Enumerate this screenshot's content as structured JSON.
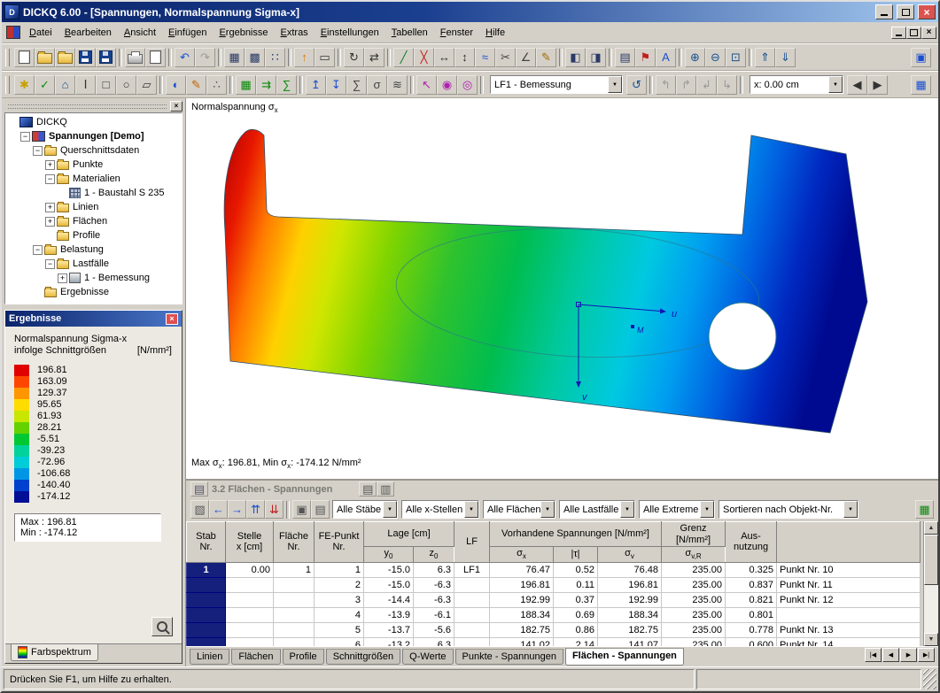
{
  "window": {
    "title": "DICKQ 6.00 - [Spannungen, Normalspannung Sigma-x]",
    "status": "Drücken Sie F1, um Hilfe zu erhalten."
  },
  "menu": {
    "items": [
      "Datei",
      "Bearbeiten",
      "Ansicht",
      "Einfügen",
      "Ergebnisse",
      "Extras",
      "Einstellungen",
      "Tabellen",
      "Fenster",
      "Hilfe"
    ]
  },
  "toolbars": {
    "main": [
      "new-file",
      "open-file",
      "open-project",
      "save",
      "save-all",
      "|",
      "print",
      "print-preview",
      "|",
      "undo",
      "redo",
      "|",
      "show-tables",
      "show-grid",
      "snap-points",
      "|",
      "move-node",
      "insert-rect",
      "|",
      "rotate-view",
      "mirror-object",
      "|",
      "insert-line",
      "delete-object",
      "dim-horizontal",
      "dim-vertical",
      "insert-polyline",
      "divide-line",
      "measure-angle",
      "edit-pencil",
      "|",
      "toggle-navigator",
      "toggle-tables",
      "|",
      "print-report",
      "edit-flag",
      "add-label",
      "|",
      "zoom-in",
      "zoom-out",
      "zoom-window",
      "|",
      "renumber-up",
      "renumber-down"
    ],
    "main_right": [
      "arrange-windows"
    ],
    "view_a": [
      "select-special",
      "check-input",
      "draw-polygon",
      "insert-beam",
      "draw-rect",
      "draw-circle",
      "region-tool",
      "|",
      "paint-fill",
      "paint-brush",
      "paint-spray",
      "|",
      "result-area",
      "result-arrows",
      "result-values",
      "|",
      "diagram-up",
      "diagram-down",
      "diagram-sum",
      "diagram-sigma",
      "diagram-smooth",
      "|",
      "pick-point",
      "show-point",
      "highlight-point",
      "|"
    ],
    "view_b": [
      "refresh-view",
      "|",
      "rotate-x",
      "rotate-y",
      "rotate-z",
      "rotate-free",
      "|"
    ],
    "view_c": [
      "step-back",
      "step-forward"
    ],
    "view_d": [
      "dock-panels"
    ],
    "loadcase": "LF1 - Bemessung",
    "xpos": "x: 0.00 cm"
  },
  "navigator": {
    "items": [
      {
        "label": "DICKQ",
        "level": 0,
        "exp": "",
        "icon": "app",
        "bold": false
      },
      {
        "label": "Spannungen [Demo]",
        "level": 1,
        "exp": "-",
        "icon": "project",
        "bold": true
      },
      {
        "label": "Querschnittsdaten",
        "level": 2,
        "exp": "-",
        "icon": "folder-open",
        "bold": false
      },
      {
        "label": "Punkte",
        "level": 3,
        "exp": "+",
        "icon": "folder",
        "bold": false
      },
      {
        "label": "Materialien",
        "level": 3,
        "exp": "-",
        "icon": "folder-open",
        "bold": false
      },
      {
        "label": "1 - Baustahl S 235",
        "level": 4,
        "exp": "",
        "icon": "material",
        "bold": false
      },
      {
        "label": "Linien",
        "level": 3,
        "exp": "+",
        "icon": "folder",
        "bold": false
      },
      {
        "label": "Flächen",
        "level": 3,
        "exp": "+",
        "icon": "folder",
        "bold": false
      },
      {
        "label": "Profile",
        "level": 3,
        "exp": "",
        "icon": "folder",
        "bold": false
      },
      {
        "label": "Belastung",
        "level": 2,
        "exp": "-",
        "icon": "folder-open",
        "bold": false
      },
      {
        "label": "Lastfälle",
        "level": 3,
        "exp": "-",
        "icon": "folder-open",
        "bold": false
      },
      {
        "label": "1 - Bemessung",
        "level": 4,
        "exp": "+",
        "icon": "loadcase",
        "bold": false
      },
      {
        "label": "Ergebnisse",
        "level": 2,
        "exp": "",
        "icon": "folder",
        "bold": false
      }
    ]
  },
  "results": {
    "title": "Ergebnisse",
    "heading1": "Normalspannung Sigma-x",
    "heading2": "infolge Schnittgrößen",
    "unit": "[N/mm²]",
    "legend": [
      {
        "value": "196.81",
        "color": "#e00000"
      },
      {
        "value": "163.09",
        "color": "#ff4600"
      },
      {
        "value": "129.37",
        "color": "#ff9600"
      },
      {
        "value": "95.65",
        "color": "#ffdc00"
      },
      {
        "value": "61.93",
        "color": "#c8e600"
      },
      {
        "value": "28.21",
        "color": "#64d200"
      },
      {
        "value": "-5.51",
        "color": "#00c832"
      },
      {
        "value": "-39.23",
        "color": "#00d29b"
      },
      {
        "value": "-72.96",
        "color": "#00cdd7"
      },
      {
        "value": "-106.68",
        "color": "#0096e6"
      },
      {
        "value": "-140.40",
        "color": "#0041cd"
      },
      {
        "value": "-174.12",
        "color": "#000f96"
      }
    ],
    "max_label": "Max : 196.81",
    "min_label": "Min : -174.12",
    "tab": "Farbspektrum"
  },
  "viewport": {
    "label_base": "Normalspannung σ",
    "label_sub": "x",
    "axis_u": "u",
    "axis_v": "v",
    "axis_m": "M",
    "footer": {
      "p1": "Max σ",
      "s1": "x",
      "p2": ": 196.81, Min σ",
      "s2": "x",
      "p3": ": -174.12 N/mm²"
    }
  },
  "table": {
    "title": "3.2 Flächen - Spannungen",
    "title_icon": "table-view",
    "header_icons": [
      "table-copy",
      "table-print"
    ],
    "toolbar_icons": [
      "table-settings",
      "nav-back",
      "nav-forward",
      "jump-first",
      "jump-last",
      "|",
      "copy-row",
      "copy-table"
    ],
    "export_icon": "export-excel",
    "filters": [
      "Alle Stäbe",
      "Alle x-Stellen",
      "Alle Flächen",
      "Alle Lastfälle",
      "Alle Extreme",
      "Sortieren nach Objekt-Nr."
    ],
    "header": {
      "stab1": "Stab",
      "stab2": "Nr.",
      "stelle1": "Stelle",
      "stelle2": "x [cm]",
      "flaeche1": "Fläche",
      "flaeche2": "Nr.",
      "fe1": "FE-Punkt",
      "fe2": "Nr.",
      "lage": "Lage [cm]",
      "y0b": "y",
      "y0s": "0",
      "z0b": "z",
      "z0s": "0",
      "lf": "LF",
      "vorh": "Vorhandene Spannungen [N/mm²]",
      "sxb": "σ",
      "sxs": "x",
      "tau": "|τ|",
      "svb": "σ",
      "svs": "v",
      "grenz": "Grenz [N/mm²]",
      "svrb": "σ",
      "svrs": "v,R",
      "aus1": "Aus-",
      "aus2": "nutzung"
    },
    "rows": [
      [
        "1",
        "0.00",
        "1",
        "1",
        "-15.0",
        "6.3",
        "LF1",
        "76.47",
        "0.52",
        "76.48",
        "235.00",
        "0.325",
        "Punkt Nr. 10"
      ],
      [
        "",
        "",
        "",
        "2",
        "-15.0",
        "-6.3",
        "",
        "196.81",
        "0.11",
        "196.81",
        "235.00",
        "0.837",
        "Punkt Nr. 11"
      ],
      [
        "",
        "",
        "",
        "3",
        "-14.4",
        "-6.3",
        "",
        "192.99",
        "0.37",
        "192.99",
        "235.00",
        "0.821",
        "Punkt Nr. 12"
      ],
      [
        "",
        "",
        "",
        "4",
        "-13.9",
        "-6.1",
        "",
        "188.34",
        "0.69",
        "188.34",
        "235.00",
        "0.801",
        ""
      ],
      [
        "",
        "",
        "",
        "5",
        "-13.7",
        "-5.6",
        "",
        "182.75",
        "0.86",
        "182.75",
        "235.00",
        "0.778",
        "Punkt Nr. 13"
      ],
      [
        "",
        "",
        "",
        "6",
        "-13.2",
        "6.3",
        "",
        "141.02",
        "2.14",
        "141.07",
        "235.00",
        "0.600",
        "Punkt Nr. 14"
      ]
    ],
    "tabs": [
      "Linien",
      "Flächen",
      "Profile",
      "Schnittgrößen",
      "Q-Werte",
      "Punkte - Spannungen",
      "Flächen - Spannungen"
    ],
    "active_tab": "Flächen - Spannungen",
    "nav": [
      "|◀",
      "◀",
      "▶",
      "▶|"
    ]
  }
}
